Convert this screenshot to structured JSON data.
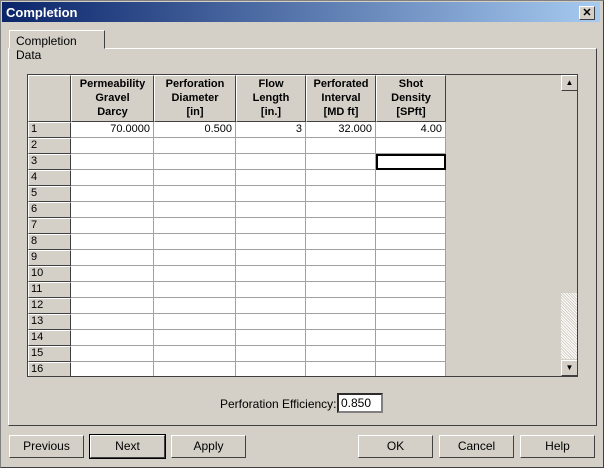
{
  "window": {
    "title": "Completion",
    "close": "✕"
  },
  "tab": "Completion Data",
  "grid": {
    "columns": [
      [
        "Permeability",
        "Gravel",
        "Darcy"
      ],
      [
        "Perforation",
        "Diameter",
        "[in]"
      ],
      [
        "Flow",
        "Length",
        "[in.]"
      ],
      [
        "Perforated",
        "Interval",
        "[MD ft]"
      ],
      [
        "Shot",
        "Density",
        "[SPft]"
      ]
    ],
    "rows": [
      "1",
      "2",
      "3",
      "4",
      "5",
      "6",
      "7",
      "8",
      "9",
      "10",
      "11",
      "12",
      "13",
      "14",
      "15",
      "16"
    ],
    "row1": [
      "70.0000",
      "0.500",
      "3",
      "32.000",
      "4.00"
    ]
  },
  "efficiency": {
    "label": "Perforation Efficiency:",
    "value": "0.850"
  },
  "buttons": {
    "previous": "Previous",
    "next": "Next",
    "apply": "Apply",
    "ok": "OK",
    "cancel": "Cancel",
    "help": "Help"
  }
}
